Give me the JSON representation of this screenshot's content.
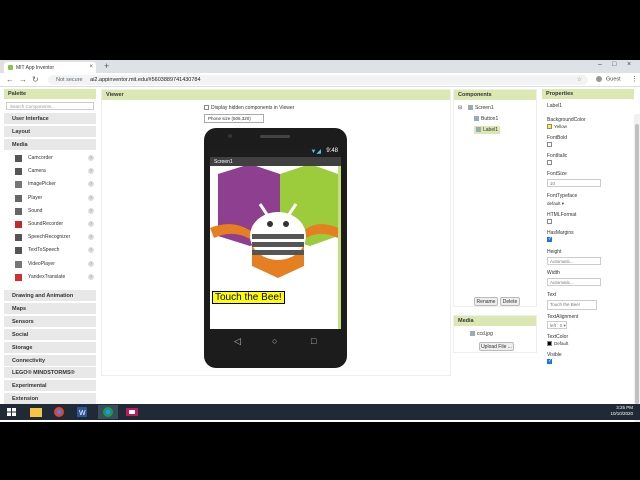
{
  "browser": {
    "tab_title": "MIT App Inventor",
    "tab_close": "×",
    "new_tab": "+",
    "win_min": "–",
    "win_max": "□",
    "win_close": "×",
    "nav_back": "←",
    "nav_forward": "→",
    "nav_reload": "↻",
    "security": "Not secure",
    "url": "ai2.appinventor.mit.edu/#5603889741430784",
    "star": "☆",
    "profile": "Guest",
    "menu": "⋮"
  },
  "palette": {
    "header": "Palette",
    "search_placeholder": "Search Components...",
    "categories_top": [
      "User Interface",
      "Layout",
      "Media"
    ],
    "media_items": [
      "Camcorder",
      "Camera",
      "ImagePicker",
      "Player",
      "Sound",
      "SoundRecorder",
      "SpeechRecognizer",
      "TextToSpeech",
      "VideoPlayer",
      "YandexTranslate"
    ],
    "categories_bottom": [
      "Drawing and Animation",
      "Maps",
      "Sensors",
      "Social",
      "Storage",
      "Connectivity",
      "LEGO® MINDSTORMS®",
      "Experimental",
      "Extension"
    ],
    "help_glyph": "?"
  },
  "viewer": {
    "header": "Viewer",
    "hidden_checkbox": "Display hidden components in Viewer",
    "size_select": "Phone size (505,320)",
    "clock": "9:48",
    "signal": "▼◢",
    "screen_title": "Screen1",
    "label_text": "Touch the Bee!",
    "nav_back": "◁",
    "nav_home": "○",
    "nav_recent": "□"
  },
  "components": {
    "header": "Components",
    "tree_toggle": "⊟",
    "tree": [
      "Screen1",
      "Button1",
      "Label1"
    ],
    "rename_button": "Rename",
    "delete_button": "Delete"
  },
  "media": {
    "header": "Media",
    "file": "ccd.jpg",
    "upload_button": "Upload File ..."
  },
  "properties": {
    "header": "Properties",
    "component": "Label1",
    "background_color_label": "BackgroundColor",
    "background_color_value": "Yellow",
    "font_bold_label": "FontBold",
    "font_italic_label": "FontItalic",
    "font_size_label": "FontSize",
    "font_size_value": "10",
    "font_typeface_label": "FontTypeface",
    "font_typeface_value": "default ▾",
    "html_format_label": "HTMLFormat",
    "has_margins_label": "HasMargins",
    "height_label": "Height",
    "height_value": "Automatic...",
    "width_label": "Width",
    "width_value": "Automatic...",
    "text_label": "Text",
    "text_value": "Touch the Bee!",
    "text_alignment_label": "TextAlignment",
    "text_alignment_value": "left : 0 ▾",
    "text_color_label": "TextColor",
    "text_color_value": "Default",
    "visible_label": "Visible",
    "font_bold": false,
    "font_italic": false,
    "html_format": false,
    "has_margins": true,
    "visible": true
  },
  "taskbar": {
    "time": "3:25 PM",
    "date": "10/10/2020"
  },
  "colors": {
    "panel_header": "#dce8b4",
    "label_bg": "#ffff00",
    "taskbar": "#1f2a36",
    "hex_purple": "#8e3f8f",
    "hex_green": "#9ccc3c",
    "hex_orange": "#e67e22"
  }
}
